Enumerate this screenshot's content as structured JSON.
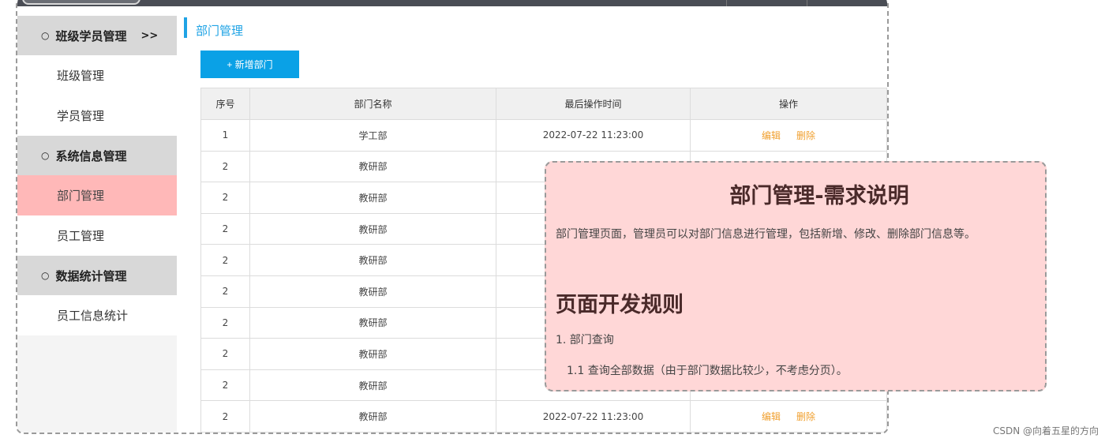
{
  "sidebar": {
    "groups": [
      {
        "label": "班级学员管理",
        "arrow": ">>",
        "items": [
          "班级管理",
          "学员管理"
        ]
      },
      {
        "label": "系统信息管理",
        "items": [
          "部门管理",
          "员工管理"
        ]
      },
      {
        "label": "数据统计管理",
        "items": [
          "员工信息统计"
        ]
      }
    ],
    "bullet": "○"
  },
  "main": {
    "breadcrumb": "部门管理",
    "add_button": "+ 新增部门",
    "table": {
      "headers": [
        "序号",
        "部门名称",
        "最后操作时间",
        "操作"
      ],
      "rows": [
        {
          "id": "1",
          "name": "学工部",
          "time": "2022-07-22 11:23:00",
          "edit": "编辑",
          "delete": "删除"
        },
        {
          "id": "2",
          "name": "教研部",
          "time": "",
          "edit": "",
          "delete": ""
        },
        {
          "id": "2",
          "name": "教研部",
          "time": "",
          "edit": "",
          "delete": ""
        },
        {
          "id": "2",
          "name": "教研部",
          "time": "",
          "edit": "",
          "delete": ""
        },
        {
          "id": "2",
          "name": "教研部",
          "time": "",
          "edit": "",
          "delete": ""
        },
        {
          "id": "2",
          "name": "教研部",
          "time": "",
          "edit": "",
          "delete": ""
        },
        {
          "id": "2",
          "name": "教研部",
          "time": "",
          "edit": "",
          "delete": ""
        },
        {
          "id": "2",
          "name": "教研部",
          "time": "",
          "edit": "",
          "delete": ""
        },
        {
          "id": "2",
          "name": "教研部",
          "time": "",
          "edit": "",
          "delete": ""
        },
        {
          "id": "2",
          "name": "教研部",
          "time": "2022-07-22 11:23:00",
          "edit": "编辑",
          "delete": "删除"
        }
      ]
    }
  },
  "note": {
    "title": "部门管理-需求说明",
    "description": "部门管理页面，管理员可以对部门信息进行管理，包括新增、修改、删除部门信息等。",
    "section_title": "页面开发规则",
    "item1": "1. 部门查询",
    "item1_1": "1.1  查询全部数据（由于部门数据比较少，不考虑分页）。"
  },
  "watermark": "CSDN @向着五星的方向",
  "colors": {
    "accent": "#1fa3e5",
    "button": "#0aa1e6",
    "active_menu": "#ffb8b8",
    "action_link": "#f0a030",
    "note_bg": "#ffd7d7"
  }
}
